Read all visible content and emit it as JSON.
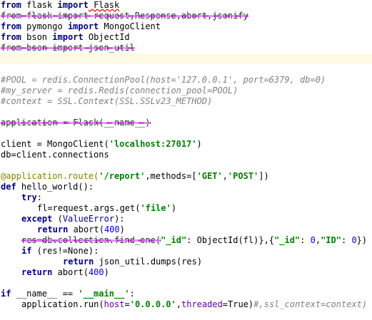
{
  "editor": {
    "lines": [
      {
        "l1_kw1": "from",
        "l1_mod": " flask ",
        "l1_kw2": "import",
        "l1_name": " Flask"
      },
      {
        "l2_text": "from flask import request,Response,abort,jsonify"
      },
      {
        "l3_kw1": "from",
        "l3_mod": " pymongo ",
        "l3_kw2": "import",
        "l3_name": " MongoClient"
      },
      {
        "l4_kw1": "from",
        "l4_mod": " bson ",
        "l4_kw2": "import",
        "l4_name": " ObjectId"
      },
      {
        "l5_text": "from bson import json_util"
      }
    ],
    "comments": [
      "#POOL = redis.ConnectionPool(host='127.0.0.1', port=6379, db=0)",
      "#my_server = redis.Redis(connection_pool=POOL)",
      "#context = SSL.Context(SSL.SSLv23_METHOD)"
    ],
    "app_line": "application = Flask(__name__)",
    "client_line": {
      "pre": "client = MongoClient(",
      "str": "'localhost:27017'",
      "post": ")"
    },
    "db_line": "db=client.connections",
    "decorator": {
      "dec": "@application.route(",
      "str1": "'/report'",
      "mid": ",methods=[",
      "str2": "'GET'",
      "comma": ",",
      "str3": "'POST'",
      "end": "])"
    },
    "def_line": {
      "kw": "def",
      "name": " hello_world():"
    },
    "try_line": {
      "kw": "try",
      "colon": ":"
    },
    "fl_line": {
      "pre": "fl=request.args.get(",
      "str": "'file'",
      "post": ")"
    },
    "except_line": {
      "kw": "except",
      "open": " (",
      "exc": "ValueError",
      "close": "):"
    },
    "return_abort": {
      "kw": "return",
      "pre": " abort(",
      "num": "400",
      "post": ")"
    },
    "res_line": {
      "pre": "res=db.collection.find_one(",
      "s1": "\"_id\"",
      "mid1": ": ObjectId(fl)},{",
      "s2": "\"_id\"",
      "mid2": ": ",
      "n1": "0",
      "comma": ",",
      "s3": "\"ID\"",
      "mid3": ": ",
      "n2": "0",
      "end": "})"
    },
    "if_res": {
      "kw": "if",
      "rest": " (res!=None):"
    },
    "return_dumps": {
      "kw": "return",
      "rest": " json_util.dumps(res)"
    },
    "return_abort2": {
      "kw": "return",
      "pre": " abort(",
      "num": "400",
      "post": ")"
    },
    "main_if": {
      "kw": "if",
      "pre": " __name__ == ",
      "str": "'__main__'",
      "post": ":"
    },
    "run_line": {
      "pre": "application.run(",
      "p1": "host",
      "eq1": "=",
      "s1": "'0.0.0.0'",
      "comma": ",",
      "p2": "threaded",
      "eq2": "=True)",
      "cmt": "#,ssl_context=context)"
    }
  }
}
